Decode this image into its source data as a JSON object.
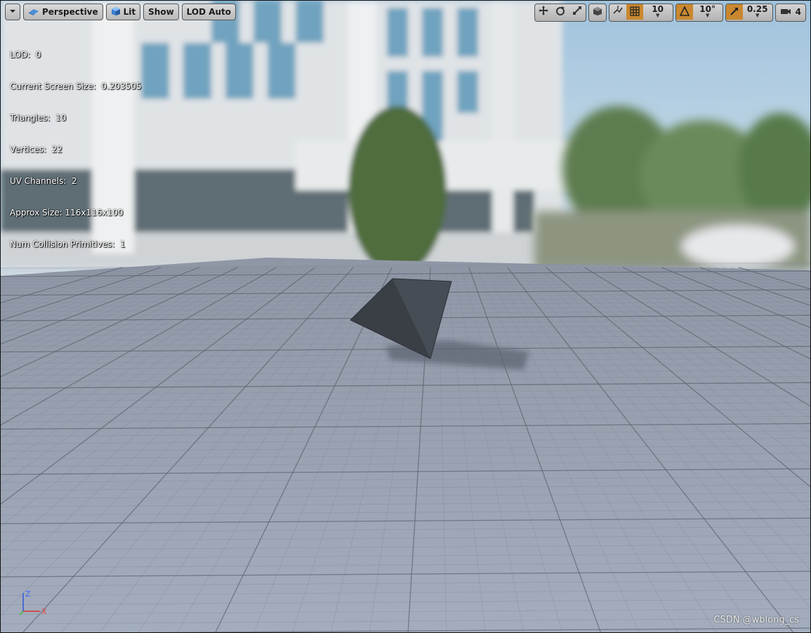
{
  "toolbar": {
    "view_mode": "Perspective",
    "lighting": "Lit",
    "show": "Show",
    "lod": "LOD Auto",
    "grid_snap_value": "10",
    "rotation_snap_value": "10°",
    "scale_snap_value": "0.25",
    "camera_speed_value": "4"
  },
  "stats": {
    "lod": "LOD:  0",
    "screen_size": "Current Screen Size:  0.203505",
    "triangles": "Triangles:  10",
    "vertices": "Vertices:  22",
    "uv_channels": "UV Channels:  2",
    "approx_size": "Approx Size: 116x116x100",
    "collision": "Num Collision Primitives:  1"
  },
  "axis": {
    "z": "Z",
    "x": "X"
  },
  "watermark": "CSDN @wblong_cs",
  "colors": {
    "active_snap": "#c9882f",
    "toolbar_bg": "#c8c8c8"
  }
}
